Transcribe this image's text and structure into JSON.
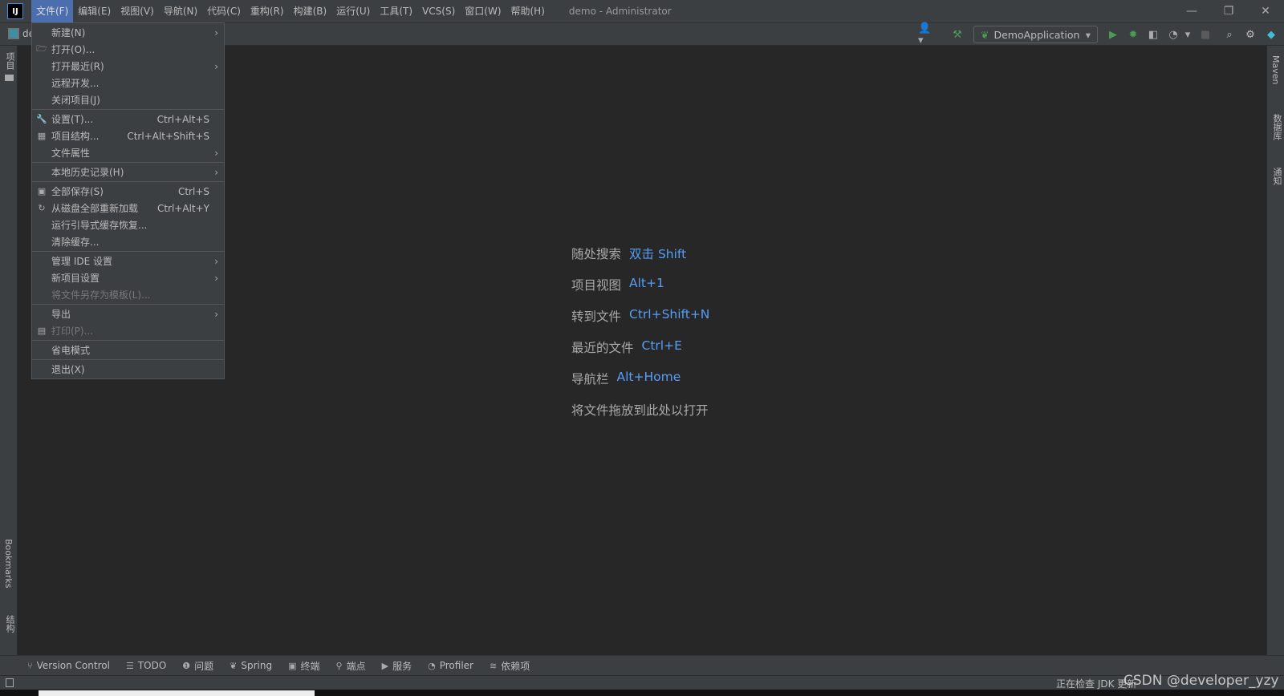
{
  "app": {
    "logo": "IJ",
    "window_title": "demo - Administrator"
  },
  "menubar": [
    "文件(F)",
    "编辑(E)",
    "视图(V)",
    "导航(N)",
    "代码(C)",
    "重构(R)",
    "构建(B)",
    "运行(U)",
    "工具(T)",
    "VCS(S)",
    "窗口(W)",
    "帮助(H)"
  ],
  "toolbar": {
    "project_tab": "de",
    "run_config": "DemoApplication"
  },
  "file_menu": [
    {
      "label": "新建(N)",
      "submenu": true
    },
    {
      "label": "打开(O)...",
      "icon": "folder-icon"
    },
    {
      "label": "打开最近(R)",
      "submenu": true
    },
    {
      "label": "远程开发..."
    },
    {
      "label": "关闭项目(J)"
    },
    {
      "sep": true
    },
    {
      "label": "设置(T)...",
      "icon": "wrench-icon",
      "shortcut": "Ctrl+Alt+S"
    },
    {
      "label": "项目结构...",
      "icon": "project-structure-icon",
      "shortcut": "Ctrl+Alt+Shift+S"
    },
    {
      "label": "文件属性",
      "submenu": true
    },
    {
      "sep": true
    },
    {
      "label": "本地历史记录(H)",
      "submenu": true
    },
    {
      "sep": true
    },
    {
      "label": "全部保存(S)",
      "icon": "save-icon",
      "shortcut": "Ctrl+S"
    },
    {
      "label": "从磁盘全部重新加载",
      "icon": "reload-icon",
      "shortcut": "Ctrl+Alt+Y"
    },
    {
      "label": "运行引导式缓存恢复..."
    },
    {
      "label": "清除缓存..."
    },
    {
      "sep": true
    },
    {
      "label": "管理 IDE 设置",
      "submenu": true
    },
    {
      "label": "新项目设置",
      "submenu": true
    },
    {
      "label": "将文件另存为模板(L)...",
      "disabled": true
    },
    {
      "sep": true
    },
    {
      "label": "导出",
      "submenu": true
    },
    {
      "label": "打印(P)...",
      "icon": "print-icon",
      "disabled": true
    },
    {
      "sep": true
    },
    {
      "label": "省电模式"
    },
    {
      "sep": true
    },
    {
      "label": "退出(X)"
    }
  ],
  "hints": [
    {
      "text": "随处搜索",
      "key": "双击 Shift"
    },
    {
      "text": "项目视图",
      "key": "Alt+1"
    },
    {
      "text": "转到文件",
      "key": "Ctrl+Shift+N"
    },
    {
      "text": "最近的文件",
      "key": "Ctrl+E"
    },
    {
      "text": "导航栏",
      "key": "Alt+Home"
    },
    {
      "text": "将文件拖放到此处以打开",
      "key": ""
    }
  ],
  "left_strip": {
    "project": "项目",
    "bookmarks": "Bookmarks",
    "structure": "结构"
  },
  "right_strip": {
    "maven": "Maven",
    "database": "数据库",
    "notifications": "通知"
  },
  "bottom_tools": [
    {
      "label": "Version Control",
      "icon": "⑂"
    },
    {
      "label": "TODO",
      "icon": "☰"
    },
    {
      "label": "问题",
      "icon": "❶"
    },
    {
      "label": "Spring",
      "icon": "❦"
    },
    {
      "label": "终端",
      "icon": "▣"
    },
    {
      "label": "端点",
      "icon": "⚲"
    },
    {
      "label": "服务",
      "icon": "▶"
    },
    {
      "label": "Profiler",
      "icon": "◔"
    },
    {
      "label": "依赖项",
      "icon": "≋"
    }
  ],
  "status": {
    "text": "正在检查 JDK 更新",
    "watermark": "CSDN @developer_yzy"
  },
  "colors": {
    "accent": "#4b6eaf",
    "link": "#589df6",
    "run_green": "#499c54"
  }
}
